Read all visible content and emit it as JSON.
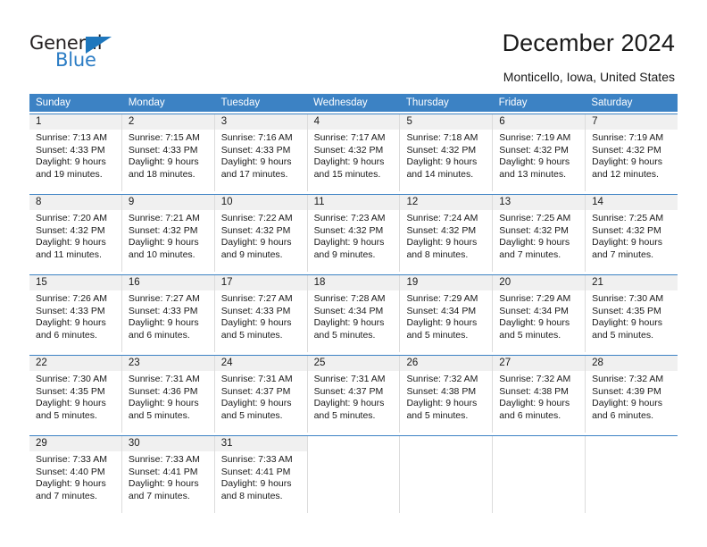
{
  "brand": {
    "name_part1": "General",
    "name_part2": "Blue",
    "triangle_icon": "triangle-icon",
    "accent_color": "#2b7cc4"
  },
  "header": {
    "title": "December 2024",
    "location": "Monticello, Iowa, United States"
  },
  "calendar": {
    "header_bg": "#3c82c4",
    "daynum_bg": "#f0f0f0",
    "weekdays": [
      "Sunday",
      "Monday",
      "Tuesday",
      "Wednesday",
      "Thursday",
      "Friday",
      "Saturday"
    ],
    "weeks": [
      [
        {
          "day": "1",
          "sunrise": "Sunrise: 7:13 AM",
          "sunset": "Sunset: 4:33 PM",
          "daylight1": "Daylight: 9 hours",
          "daylight2": "and 19 minutes."
        },
        {
          "day": "2",
          "sunrise": "Sunrise: 7:15 AM",
          "sunset": "Sunset: 4:33 PM",
          "daylight1": "Daylight: 9 hours",
          "daylight2": "and 18 minutes."
        },
        {
          "day": "3",
          "sunrise": "Sunrise: 7:16 AM",
          "sunset": "Sunset: 4:33 PM",
          "daylight1": "Daylight: 9 hours",
          "daylight2": "and 17 minutes."
        },
        {
          "day": "4",
          "sunrise": "Sunrise: 7:17 AM",
          "sunset": "Sunset: 4:32 PM",
          "daylight1": "Daylight: 9 hours",
          "daylight2": "and 15 minutes."
        },
        {
          "day": "5",
          "sunrise": "Sunrise: 7:18 AM",
          "sunset": "Sunset: 4:32 PM",
          "daylight1": "Daylight: 9 hours",
          "daylight2": "and 14 minutes."
        },
        {
          "day": "6",
          "sunrise": "Sunrise: 7:19 AM",
          "sunset": "Sunset: 4:32 PM",
          "daylight1": "Daylight: 9 hours",
          "daylight2": "and 13 minutes."
        },
        {
          "day": "7",
          "sunrise": "Sunrise: 7:19 AM",
          "sunset": "Sunset: 4:32 PM",
          "daylight1": "Daylight: 9 hours",
          "daylight2": "and 12 minutes."
        }
      ],
      [
        {
          "day": "8",
          "sunrise": "Sunrise: 7:20 AM",
          "sunset": "Sunset: 4:32 PM",
          "daylight1": "Daylight: 9 hours",
          "daylight2": "and 11 minutes."
        },
        {
          "day": "9",
          "sunrise": "Sunrise: 7:21 AM",
          "sunset": "Sunset: 4:32 PM",
          "daylight1": "Daylight: 9 hours",
          "daylight2": "and 10 minutes."
        },
        {
          "day": "10",
          "sunrise": "Sunrise: 7:22 AM",
          "sunset": "Sunset: 4:32 PM",
          "daylight1": "Daylight: 9 hours",
          "daylight2": "and 9 minutes."
        },
        {
          "day": "11",
          "sunrise": "Sunrise: 7:23 AM",
          "sunset": "Sunset: 4:32 PM",
          "daylight1": "Daylight: 9 hours",
          "daylight2": "and 9 minutes."
        },
        {
          "day": "12",
          "sunrise": "Sunrise: 7:24 AM",
          "sunset": "Sunset: 4:32 PM",
          "daylight1": "Daylight: 9 hours",
          "daylight2": "and 8 minutes."
        },
        {
          "day": "13",
          "sunrise": "Sunrise: 7:25 AM",
          "sunset": "Sunset: 4:32 PM",
          "daylight1": "Daylight: 9 hours",
          "daylight2": "and 7 minutes."
        },
        {
          "day": "14",
          "sunrise": "Sunrise: 7:25 AM",
          "sunset": "Sunset: 4:32 PM",
          "daylight1": "Daylight: 9 hours",
          "daylight2": "and 7 minutes."
        }
      ],
      [
        {
          "day": "15",
          "sunrise": "Sunrise: 7:26 AM",
          "sunset": "Sunset: 4:33 PM",
          "daylight1": "Daylight: 9 hours",
          "daylight2": "and 6 minutes."
        },
        {
          "day": "16",
          "sunrise": "Sunrise: 7:27 AM",
          "sunset": "Sunset: 4:33 PM",
          "daylight1": "Daylight: 9 hours",
          "daylight2": "and 6 minutes."
        },
        {
          "day": "17",
          "sunrise": "Sunrise: 7:27 AM",
          "sunset": "Sunset: 4:33 PM",
          "daylight1": "Daylight: 9 hours",
          "daylight2": "and 5 minutes."
        },
        {
          "day": "18",
          "sunrise": "Sunrise: 7:28 AM",
          "sunset": "Sunset: 4:34 PM",
          "daylight1": "Daylight: 9 hours",
          "daylight2": "and 5 minutes."
        },
        {
          "day": "19",
          "sunrise": "Sunrise: 7:29 AM",
          "sunset": "Sunset: 4:34 PM",
          "daylight1": "Daylight: 9 hours",
          "daylight2": "and 5 minutes."
        },
        {
          "day": "20",
          "sunrise": "Sunrise: 7:29 AM",
          "sunset": "Sunset: 4:34 PM",
          "daylight1": "Daylight: 9 hours",
          "daylight2": "and 5 minutes."
        },
        {
          "day": "21",
          "sunrise": "Sunrise: 7:30 AM",
          "sunset": "Sunset: 4:35 PM",
          "daylight1": "Daylight: 9 hours",
          "daylight2": "and 5 minutes."
        }
      ],
      [
        {
          "day": "22",
          "sunrise": "Sunrise: 7:30 AM",
          "sunset": "Sunset: 4:35 PM",
          "daylight1": "Daylight: 9 hours",
          "daylight2": "and 5 minutes."
        },
        {
          "day": "23",
          "sunrise": "Sunrise: 7:31 AM",
          "sunset": "Sunset: 4:36 PM",
          "daylight1": "Daylight: 9 hours",
          "daylight2": "and 5 minutes."
        },
        {
          "day": "24",
          "sunrise": "Sunrise: 7:31 AM",
          "sunset": "Sunset: 4:37 PM",
          "daylight1": "Daylight: 9 hours",
          "daylight2": "and 5 minutes."
        },
        {
          "day": "25",
          "sunrise": "Sunrise: 7:31 AM",
          "sunset": "Sunset: 4:37 PM",
          "daylight1": "Daylight: 9 hours",
          "daylight2": "and 5 minutes."
        },
        {
          "day": "26",
          "sunrise": "Sunrise: 7:32 AM",
          "sunset": "Sunset: 4:38 PM",
          "daylight1": "Daylight: 9 hours",
          "daylight2": "and 5 minutes."
        },
        {
          "day": "27",
          "sunrise": "Sunrise: 7:32 AM",
          "sunset": "Sunset: 4:38 PM",
          "daylight1": "Daylight: 9 hours",
          "daylight2": "and 6 minutes."
        },
        {
          "day": "28",
          "sunrise": "Sunrise: 7:32 AM",
          "sunset": "Sunset: 4:39 PM",
          "daylight1": "Daylight: 9 hours",
          "daylight2": "and 6 minutes."
        }
      ],
      [
        {
          "day": "29",
          "sunrise": "Sunrise: 7:33 AM",
          "sunset": "Sunset: 4:40 PM",
          "daylight1": "Daylight: 9 hours",
          "daylight2": "and 7 minutes."
        },
        {
          "day": "30",
          "sunrise": "Sunrise: 7:33 AM",
          "sunset": "Sunset: 4:41 PM",
          "daylight1": "Daylight: 9 hours",
          "daylight2": "and 7 minutes."
        },
        {
          "day": "31",
          "sunrise": "Sunrise: 7:33 AM",
          "sunset": "Sunset: 4:41 PM",
          "daylight1": "Daylight: 9 hours",
          "daylight2": "and 8 minutes."
        },
        {
          "day": "",
          "sunrise": "",
          "sunset": "",
          "daylight1": "",
          "daylight2": ""
        },
        {
          "day": "",
          "sunrise": "",
          "sunset": "",
          "daylight1": "",
          "daylight2": ""
        },
        {
          "day": "",
          "sunrise": "",
          "sunset": "",
          "daylight1": "",
          "daylight2": ""
        },
        {
          "day": "",
          "sunrise": "",
          "sunset": "",
          "daylight1": "",
          "daylight2": ""
        }
      ]
    ]
  }
}
